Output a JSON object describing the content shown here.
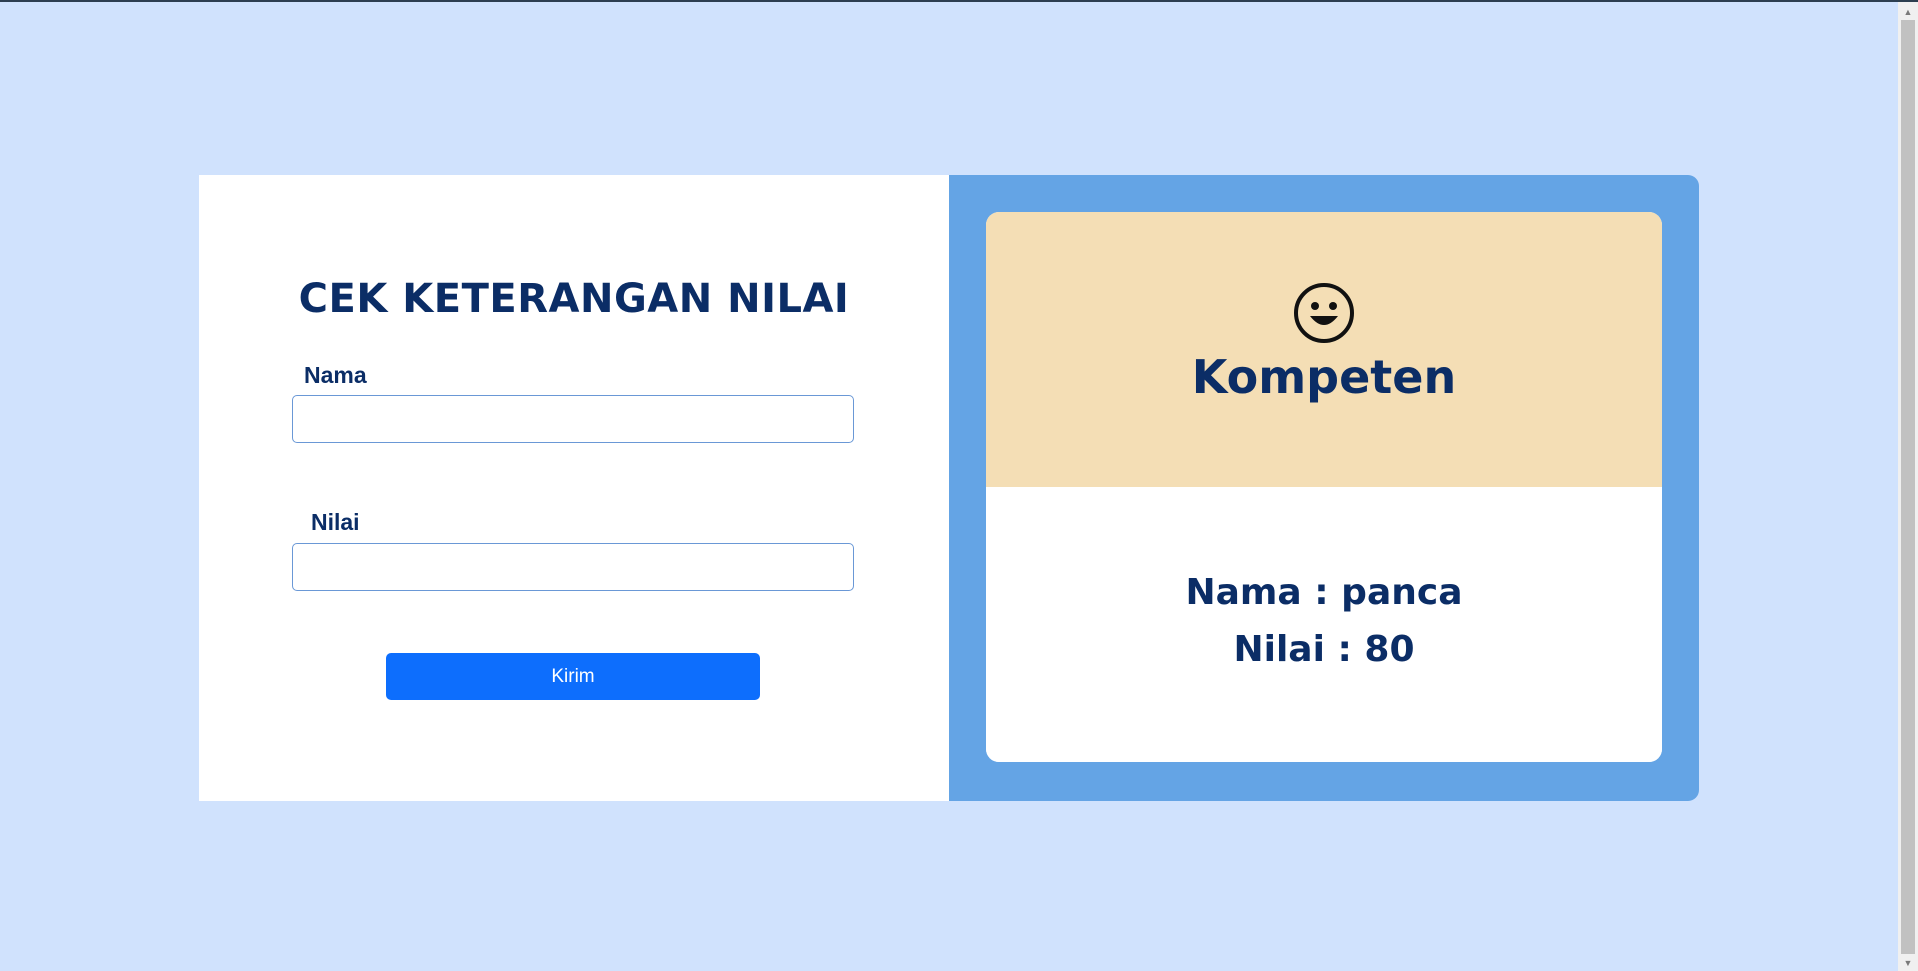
{
  "form": {
    "title": "CEK KETERANGAN NILAI",
    "nama_label": "Nama",
    "nama_value": "",
    "nilai_label": "Nilai",
    "nilai_value": "",
    "submit_label": "Kirim"
  },
  "result": {
    "icon": "smiley-face-icon",
    "status": "Kompeten",
    "nama_line": "Nama : panca",
    "nilai_line": "Nilai : 80"
  },
  "colors": {
    "page_background": "#d0e2fd",
    "heading": "#0b2d66",
    "button": "#0d6efd",
    "result_frame": "#64a4e5",
    "status_background": "#f4deb5"
  }
}
